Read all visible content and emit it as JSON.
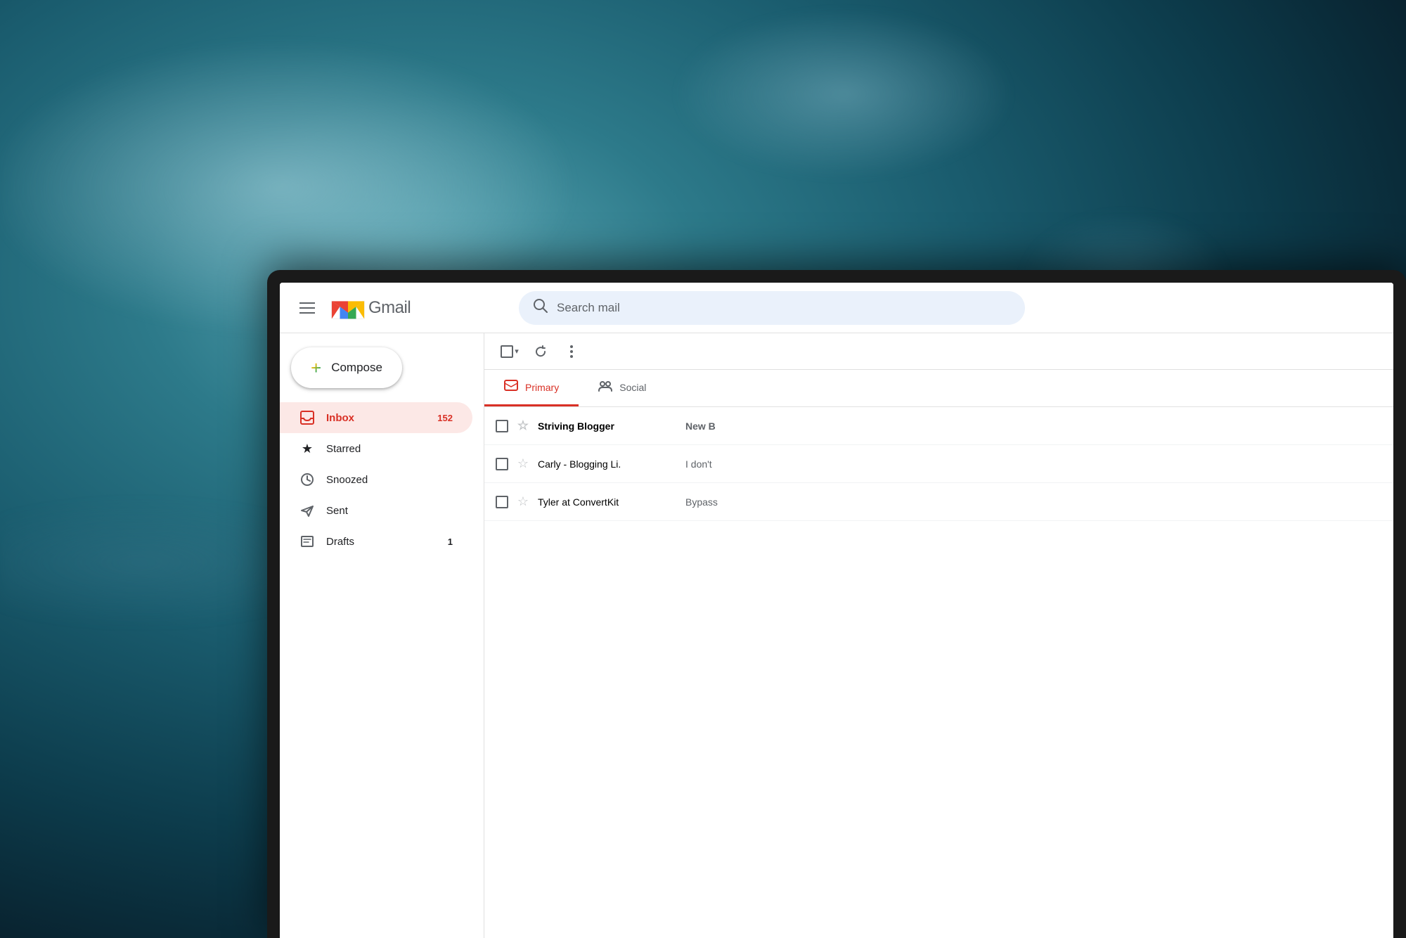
{
  "background": {
    "alt": "Blurred blue ocean/sky background"
  },
  "gmail": {
    "header": {
      "menu_icon_label": "Menu",
      "logo_text": "Gmail",
      "search_placeholder": "Search mail"
    },
    "sidebar": {
      "compose_label": "Compose",
      "items": [
        {
          "id": "inbox",
          "label": "Inbox",
          "count": "152",
          "active": true
        },
        {
          "id": "starred",
          "label": "Starred",
          "count": "",
          "active": false
        },
        {
          "id": "snoozed",
          "label": "Snoozed",
          "count": "",
          "active": false
        },
        {
          "id": "sent",
          "label": "Sent",
          "count": "",
          "active": false
        },
        {
          "id": "drafts",
          "label": "Drafts",
          "count": "1",
          "active": false
        }
      ]
    },
    "toolbar": {
      "select_all_label": "Select",
      "refresh_label": "Refresh",
      "more_label": "More"
    },
    "tabs": [
      {
        "id": "primary",
        "label": "Primary",
        "active": true
      },
      {
        "id": "social",
        "label": "Social",
        "active": false
      }
    ],
    "email_rows": [
      {
        "sender": "Striving Blogger",
        "subject": "New B",
        "unread": true
      },
      {
        "sender": "Carly - Blogging Li.",
        "subject": "I don't",
        "unread": false
      },
      {
        "sender": "Tyler at ConvertKit",
        "subject": "Bypass",
        "unread": false
      }
    ]
  },
  "colors": {
    "gmail_red": "#d93025",
    "gmail_blue": "#4285f4",
    "gmail_green": "#34a853",
    "gmail_yellow": "#fbbc04",
    "text_primary": "#202124",
    "text_secondary": "#5f6368",
    "active_bg": "#fce8e6",
    "search_bg": "#eaf1fb",
    "border": "#e0e0e0"
  }
}
